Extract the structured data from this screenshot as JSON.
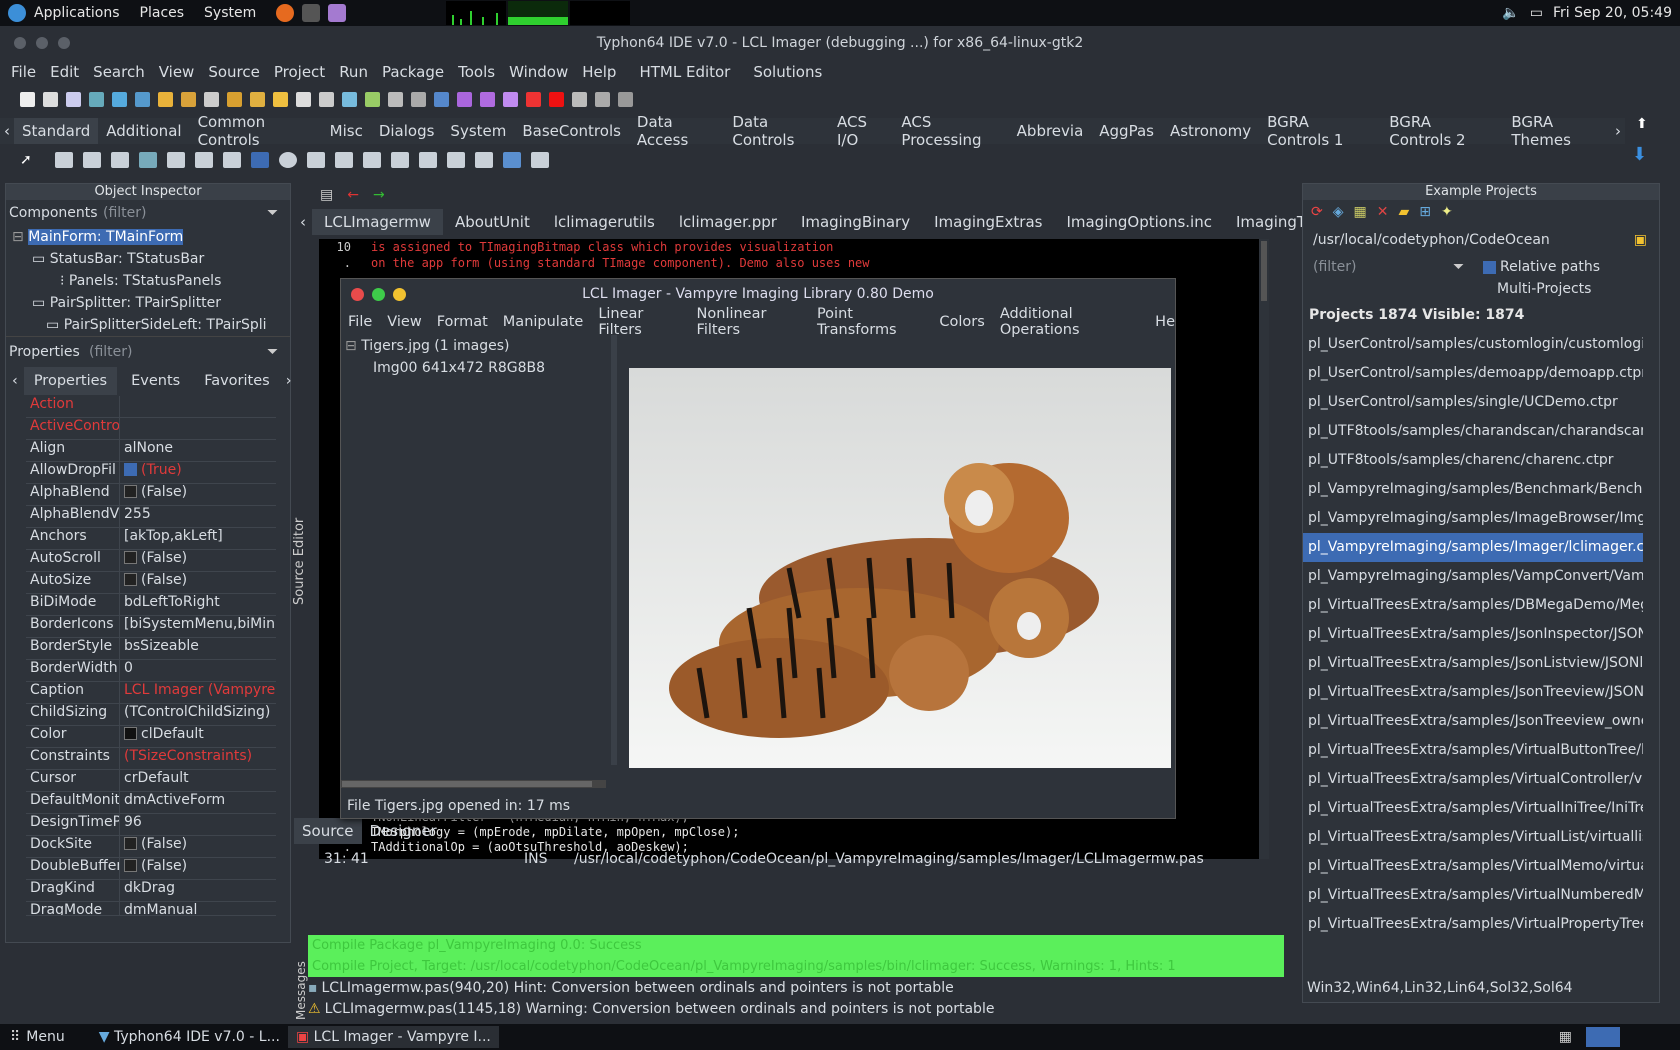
{
  "topbar": {
    "menus": [
      "Applications",
      "Places",
      "System"
    ],
    "datetime": "Fri Sep 20, 05:49"
  },
  "window": {
    "title": "Typhon64 IDE v7.0 - LCL Imager (debugging ...) for x86_64-linux-gtk2"
  },
  "menubar": [
    "File",
    "Edit",
    "Search",
    "View",
    "Source",
    "Project",
    "Run",
    "Package",
    "Tools",
    "Window",
    "Help",
    "HTML Editor",
    "Solutions"
  ],
  "palette_tabs": [
    "Standard",
    "Additional",
    "Common Controls",
    "Misc",
    "Dialogs",
    "System",
    "BaseControls",
    "Data Access",
    "Data Controls",
    "ACS I/O",
    "ACS Processing",
    "Abbrevia",
    "AggPas",
    "Astronomy",
    "BGRA Controls 1",
    "BGRA Controls 2",
    "BGRA Themes"
  ],
  "object_inspector": {
    "title": "Object Inspector",
    "components_label": "Components",
    "filter": "(filter)",
    "tree": [
      "MainForm: TMainForm",
      "StatusBar: TStatusBar",
      "Panels: TStatusPanels",
      "PairSplitter: TPairSplitter",
      "PairSplitterSideLeft: TPairSpli"
    ],
    "properties_label": "Properties",
    "tabs": [
      "Properties",
      "Events",
      "Favorites"
    ],
    "props": [
      [
        "Action",
        ""
      ],
      [
        "ActiveControl",
        ""
      ],
      [
        "Align",
        "alNone"
      ],
      [
        "AllowDropFil",
        "(True)"
      ],
      [
        "AlphaBlend",
        "(False)"
      ],
      [
        "AlphaBlendVa",
        "255"
      ],
      [
        "Anchors",
        "[akTop,akLeft]"
      ],
      [
        "AutoScroll",
        "(False)"
      ],
      [
        "AutoSize",
        "(False)"
      ],
      [
        "BiDiMode",
        "bdLeftToRight"
      ],
      [
        "BorderIcons",
        "[biSystemMenu,biMini"
      ],
      [
        "BorderStyle",
        "bsSizeable"
      ],
      [
        "BorderWidth",
        "0"
      ],
      [
        "Caption",
        "LCL Imager (Vampyre"
      ],
      [
        "ChildSizing",
        "(TControlChildSizing)"
      ],
      [
        "Color",
        "clDefault"
      ],
      [
        "Constraints",
        "(TSizeConstraints)"
      ],
      [
        "Cursor",
        "crDefault"
      ],
      [
        "DefaultMonito",
        "dmActiveForm"
      ],
      [
        "DesignTimeP",
        "96"
      ],
      [
        "DockSite",
        "(False)"
      ],
      [
        "DoubleBuffer",
        "(False)"
      ],
      [
        "DragKind",
        "dkDrag"
      ],
      [
        "DragMode",
        "dmManual"
      ]
    ]
  },
  "source_editor": {
    "side_label": "Source Editor",
    "tabs": [
      "LCLImagermw",
      "AboutUnit",
      "lclimagerutils",
      "lclimager.ppr",
      "ImagingBinary",
      "ImagingExtras",
      "ImagingOptions.inc",
      "ImagingTypes"
    ],
    "code_top": [
      {
        "ln": "10",
        "text": "is assigned to TImagingBitmap class which provides visualization"
      },
      {
        "ln": ".",
        "text": "on the app form (using standard TImage component). Demo also uses new"
      }
    ],
    "code_bottom": [
      {
        "ln": ".",
        "text": "TNonLinearFilter = (nfMedian, nfMin, nfMax);"
      },
      {
        "ln": ".",
        "text": "TMorphology = (mpErode, mpDilate, mpOpen, mpClose);"
      },
      {
        "ln": ".",
        "text": "TAdditionalOp = (aoOtsuThreshold, aoDeskew);"
      }
    ],
    "bottom_tabs": [
      "Source",
      "Designer"
    ],
    "status": {
      "pos": "31: 41",
      "mode": "INS",
      "path": "/usr/local/codetyphon/CodeOcean/pl_VampyreImaging/samples/Imager/LCLImagermw.pas"
    }
  },
  "imager": {
    "title": "LCL Imager - Vampyre Imaging Library 0.80 Demo",
    "menu": [
      "File",
      "View",
      "Format",
      "Manipulate",
      "Linear Filters",
      "Nonlinear Filters",
      "Point Transforms",
      "Colors",
      "Additional Operations",
      "He"
    ],
    "tree": [
      "Tigers.jpg (1 images)",
      "Img00 641x472 R8G8B8"
    ],
    "status": "File Tigers.jpg opened in: 17 ms"
  },
  "messages": {
    "green1": "Compile Package pl_VampyreImaging 0.0: Success",
    "green2": "Compile Project, Target: /usr/local/codetyphon/CodeOcean/pl_VampyreImaging/samples/bin/lclimager: Success, Warnings: 1, Hints: 1",
    "lines": [
      "LCLImagermw.pas(940,20) Hint: Conversion between ordinals and pointers is not portable",
      "LCLImagermw.pas(1145,18) Warning: Conversion between ordinals and pointers is not portable"
    ],
    "side_label": "Messages"
  },
  "example_projects": {
    "title": "Example Projects",
    "path": "/usr/local/codetyphon/CodeOcean",
    "filter": "(filter)",
    "relative_paths": "Relative paths",
    "multi_projects": "Multi-Projects",
    "counts": "Projects 1874  Visible: 1874",
    "selected_index": 7,
    "list": [
      "pl_UserControl/samples/customlogin/customlogin.",
      "pl_UserControl/samples/demoapp/demoapp.ctpr",
      "pl_UserControl/samples/single/UCDemo.ctpr",
      "pl_UTF8tools/samples/charandscan/charandscan.c",
      "pl_UTF8tools/samples/charenc/charenc.ctpr",
      "pl_VampyreImaging/samples/Benchmark/Bench.ct",
      "pl_VampyreImaging/samples/ImageBrowser/ImgB",
      "pl_VampyreImaging/samples/Imager/lclimager.ctp",
      "pl_VampyreImaging/samples/VampConvert/VampC",
      "pl_VirtualTreesExtra/samples/DBMegaDemo/Meg",
      "pl_VirtualTreesExtra/samples/JsonInspector/JSON",
      "pl_VirtualTreesExtra/samples/JsonListview/JSONl",
      "pl_VirtualTreesExtra/samples/JsonTreeview/JSON",
      "pl_VirtualTreesExtra/samples/JsonTreeview_owne",
      "pl_VirtualTreesExtra/samples/VirtualButtonTree/b",
      "pl_VirtualTreesExtra/samples/VirtualController/vir",
      "pl_VirtualTreesExtra/samples/VirtualIniTree/IniTre",
      "pl_VirtualTreesExtra/samples/VirtualList/virtuallist",
      "pl_VirtualTreesExtra/samples/VirtualMemo/virtual",
      "pl_VirtualTreesExtra/samples/VirtualNumberedMe",
      "pl_VirtualTreesExtra/samples/VirtualPropertyTree"
    ],
    "platforms": "Win32,Win64,Lin32,Lin64,Sol32,Sol64"
  },
  "taskbar": {
    "menu": "Menu",
    "items": [
      "Typhon64 IDE v7.0 - L...",
      "LCL Imager - Vampyre I..."
    ]
  }
}
